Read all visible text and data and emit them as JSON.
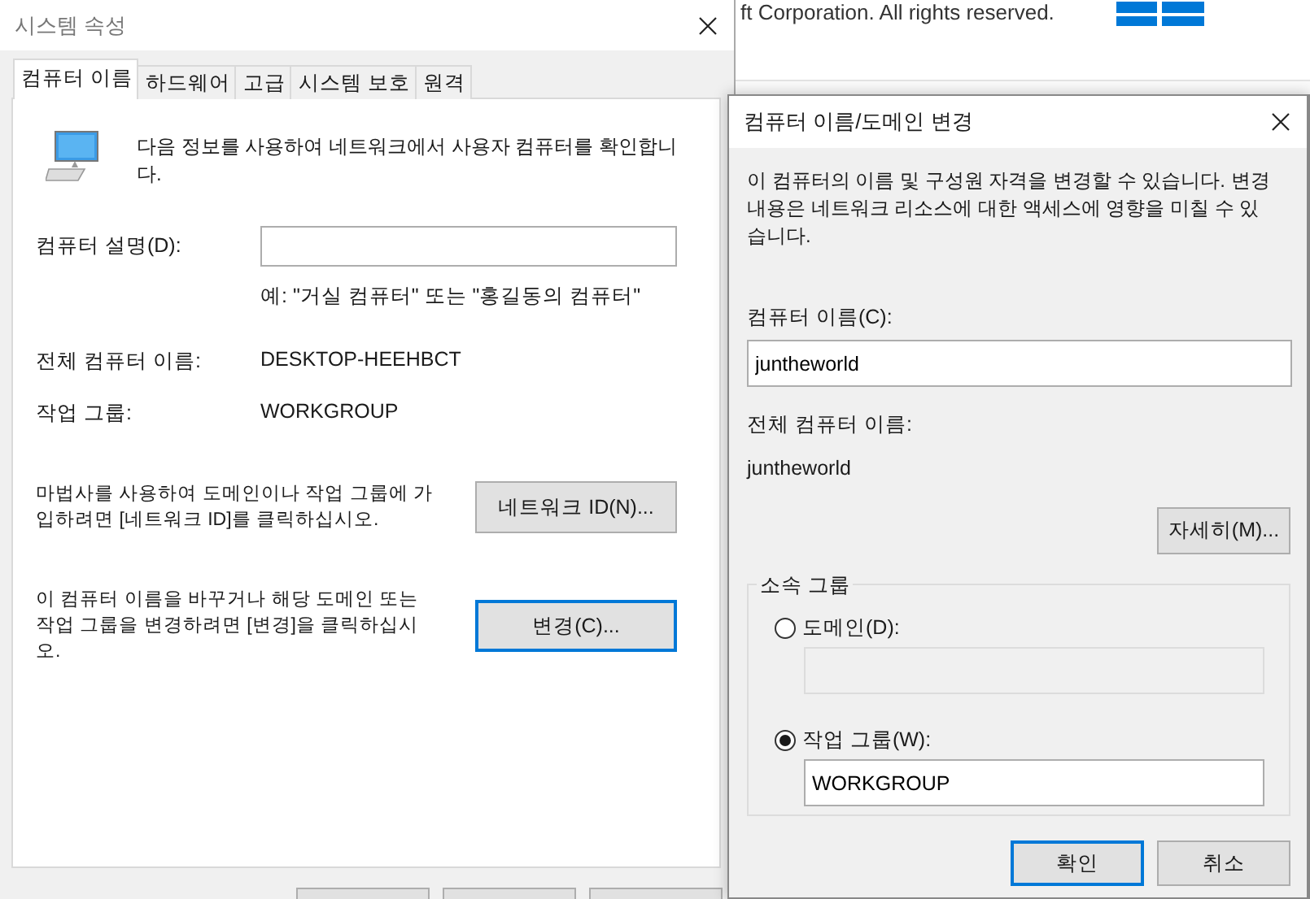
{
  "background_window": {
    "copyright": "ft Corporation. All rights reserved."
  },
  "system_properties": {
    "title": "시스템 속성",
    "tabs": [
      {
        "label": "컴퓨터 이름",
        "selected": true
      },
      {
        "label": "하드웨어",
        "selected": false
      },
      {
        "label": "고급",
        "selected": false
      },
      {
        "label": "시스템 보호",
        "selected": false
      },
      {
        "label": "원격",
        "selected": false
      }
    ],
    "intro": "다음 정보를 사용하여 네트워크에서 사용자 컴퓨터를 확인합니다.",
    "description": {
      "label": "컴퓨터 설명(D):",
      "hint": "예: \"거실 컴퓨터\" 또는 \"홍길동의 컴퓨터\""
    },
    "info": [
      {
        "label": "전체 컴퓨터 이름:",
        "value": "DESKTOP-HEEHBCT"
      },
      {
        "label": "작업 그룹:",
        "value": "WORKGROUP"
      }
    ],
    "actions": [
      {
        "text": "마법사를 사용하여 도메인이나 작업 그룹에 가입하려면 [네트워크 ID]를 클릭하십시오.",
        "button": "네트워크 ID(N)...",
        "focused": false
      },
      {
        "text": "이 컴퓨터 이름을 바꾸거나 해당 도메인 또는 작업 그룹을 변경하려면 [변경]을 클릭하십시오.",
        "button": "변경(C)...",
        "focused": true
      }
    ]
  },
  "change_dialog": {
    "title": "컴퓨터 이름/도메인 변경",
    "message": "이 컴퓨터의 이름 및 구성원 자격을 변경할 수 있습니다. 변경 내용은 네트워크 리소스에 대한 액세스에 영향을 미칠 수 있습니다.",
    "name_label": "컴퓨터 이름(C):",
    "name_value": "juntheworld",
    "full_name_label": "전체 컴퓨터 이름:",
    "full_name_value": "juntheworld",
    "more_button": "자세히(M)...",
    "membership": {
      "title": "소속 그룹",
      "options": [
        {
          "label": "도메인(D):",
          "selected": false
        },
        {
          "label": "작업 그룹(W):",
          "selected": true,
          "value": "WORKGROUP"
        }
      ]
    },
    "buttons": [
      {
        "label": "확인",
        "default": true
      },
      {
        "label": "취소",
        "default": false
      }
    ]
  }
}
